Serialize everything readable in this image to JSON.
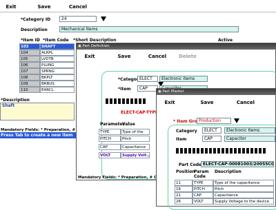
{
  "main": {
    "toolbar": {
      "exit": "Exit",
      "save": "Save",
      "cancel": "Cancel"
    },
    "category_id_label": "*Category ID",
    "category_id_value": "24",
    "description_label": "Description",
    "description_value": "Mechanical Items",
    "headers": {
      "item_id": "*Item ID",
      "item_code": "*Item Code",
      "short_desc": "*Short Description",
      "active": "Active"
    },
    "rows": [
      {
        "id": "103",
        "code": "SHAFT"
      },
      {
        "id": "104",
        "code": "ALRPL"
      },
      {
        "id": "105",
        "code": "LVDTB"
      },
      {
        "id": "106",
        "code": "PLUNG"
      },
      {
        "id": "107",
        "code": "SPRNG"
      },
      {
        "id": "108",
        "code": "BKPLT"
      },
      {
        "id": "109",
        "code": "BRBUS"
      },
      {
        "id": "110",
        "code": "EARCL"
      }
    ],
    "desc2_label": "*Description",
    "desc2_value": "Shaft",
    "mandatory": "Mandatory Fields: * Preparation, # Check",
    "status": "Press Tab to create a new item"
  },
  "part_def": {
    "title": "Part Definition",
    "toolbar": {
      "exit": "Exit",
      "save": "Save",
      "cancel": "Cancel",
      "delete": "Delete"
    },
    "category_label": "*Category",
    "category_value": "ELECT",
    "category_desc": "Electronic Items",
    "item_label": "*Item",
    "item_value": "CAP",
    "item_desc": "Capacitor",
    "code_label": "ELECT-CAP-TYPEP(",
    "headers": {
      "parameter": "Parameter",
      "value": "Value"
    },
    "rows": [
      {
        "param": "TYPE",
        "desc": "Type of the"
      },
      {
        "param": "PITCH",
        "desc": "Pitch"
      },
      {
        "param": "CAP",
        "desc": "Capacitance"
      },
      {
        "param": "VOLT",
        "desc": "Supply Volt..."
      }
    ],
    "mandatory": "Mandatory Fields: * Preparation, # Check, $ Ap"
  },
  "part_master": {
    "title": "Part Master",
    "toolbar": {
      "exit": "Exit",
      "save": "Save",
      "cancel": "Cancel"
    },
    "item_group_label": "* Item Group?",
    "item_group_value": "Production",
    "category_label": "Category",
    "category_value": "ELECT",
    "category_desc": "Electronic Items",
    "item_label": "Item",
    "item_value": "CAP",
    "item_desc": "Capacitor",
    "part_code_label": "Part Code",
    "part_code_value": "ELECT-CAP-00081003/20055C001V2",
    "headers": {
      "position": "Position",
      "param_code": "Param Code",
      "description": "Description"
    },
    "rows": [
      {
        "pos": "11",
        "code": "TYPE",
        "desc": "Type of the capacitance"
      },
      {
        "pos": "16",
        "code": "PITCH",
        "desc": "Pitch"
      },
      {
        "pos": "21",
        "code": "CAP",
        "desc": "Capacitance"
      },
      {
        "pos": "26",
        "code": "VOLT",
        "desc": "Supply Voltage to the device"
      }
    ]
  }
}
